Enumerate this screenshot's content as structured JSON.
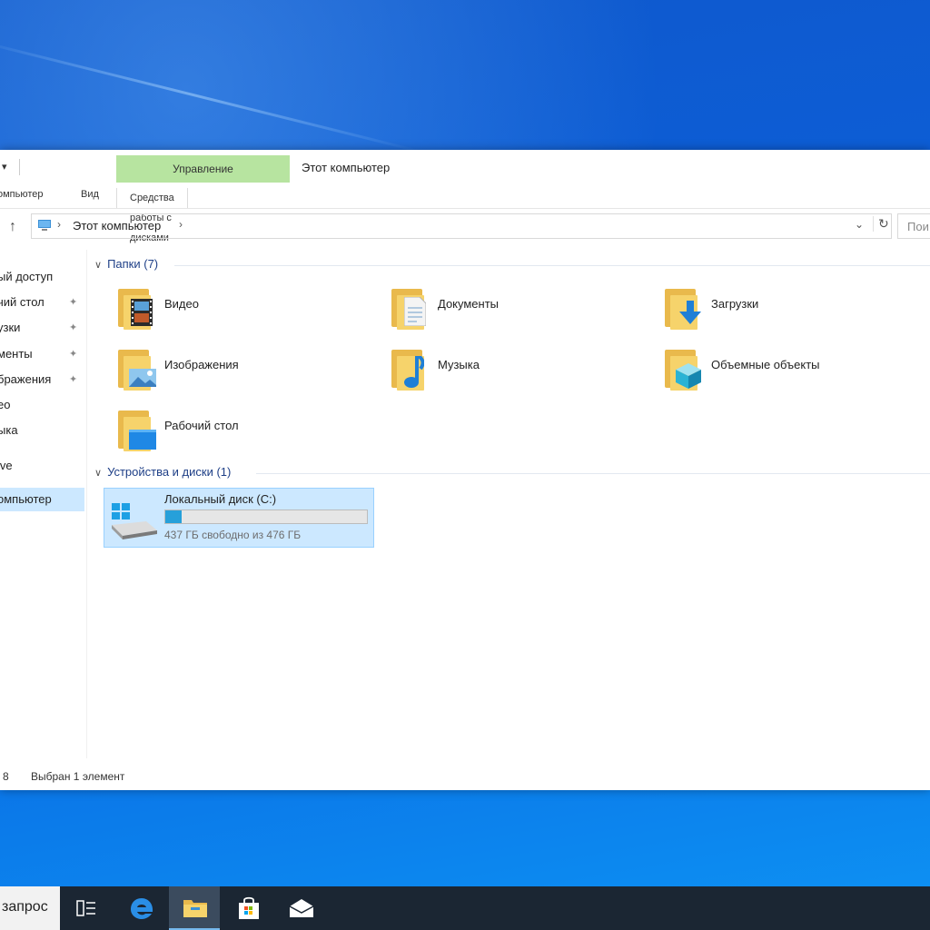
{
  "window": {
    "title": "Этот компьютер",
    "quick_access_glyph": "▾",
    "context_tab_header": "Управление",
    "tabs": [
      {
        "label": "омпьютер"
      },
      {
        "label": "Вид"
      },
      {
        "label": "Средства работы с дисками"
      }
    ]
  },
  "address": {
    "path": "Этот компьютер",
    "chevron": "›",
    "dropdown_icon": "chevron-down-icon",
    "refresh_icon": "refresh-icon",
    "search_placeholder": "Пои"
  },
  "nav": {
    "items": [
      {
        "label": "ый доступ",
        "pinned": false
      },
      {
        "label": "чий стол",
        "pinned": true
      },
      {
        "label": "узки",
        "pinned": true
      },
      {
        "label": "менты",
        "pinned": true
      },
      {
        "label": "бражения",
        "pinned": true
      },
      {
        "label": "ео",
        "pinned": false
      },
      {
        "label": "ыка",
        "pinned": false
      },
      {
        "label": "ive",
        "pinned": false
      },
      {
        "label": "омпьютер",
        "pinned": false,
        "selected": true
      }
    ]
  },
  "folders": {
    "header": "Папки (7)",
    "items": [
      {
        "name": "Видео",
        "icon": "video-folder-icon"
      },
      {
        "name": "Документы",
        "icon": "documents-folder-icon"
      },
      {
        "name": "Загрузки",
        "icon": "downloads-folder-icon"
      },
      {
        "name": "Изображения",
        "icon": "pictures-folder-icon"
      },
      {
        "name": "Музыка",
        "icon": "music-folder-icon"
      },
      {
        "name": "Объемные объекты",
        "icon": "3d-objects-folder-icon"
      },
      {
        "name": "Рабочий стол",
        "icon": "desktop-folder-icon"
      }
    ]
  },
  "devices": {
    "header": "Устройства и диски (1)",
    "drives": [
      {
        "name": "Локальный диск (C:)",
        "free_text": "437 ГБ свободно из 476 ГБ",
        "used_fraction": 0.082,
        "bar_color": "#26a0da"
      }
    ]
  },
  "status": {
    "count": "8",
    "selection": "Выбран 1 элемент"
  },
  "taskbar": {
    "search_text": "запрос",
    "buttons": [
      {
        "icon": "task-view-icon"
      },
      {
        "icon": "edge-icon"
      },
      {
        "icon": "file-explorer-icon",
        "active": true
      },
      {
        "icon": "store-icon"
      },
      {
        "icon": "mail-icon"
      }
    ]
  },
  "colors": {
    "accent": "#0078d7",
    "context_tab": "#b7e4a0",
    "selection": "#cce8ff",
    "group_header": "#1e3f87"
  }
}
